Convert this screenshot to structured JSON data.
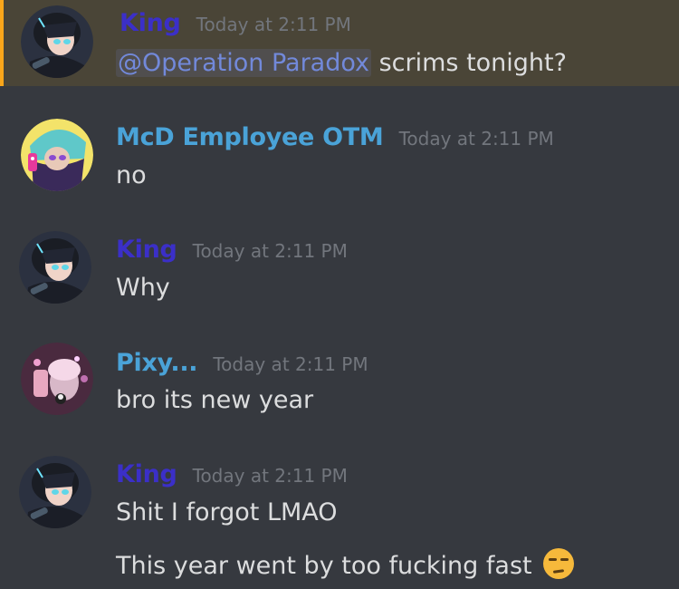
{
  "colors": {
    "background": "#36393f",
    "mention_highlight": "#4a4537",
    "mention_bar": "#faa61a",
    "king_name": "#3b2fc8",
    "member_name": "#4aa3d8",
    "timestamp": "#72767d",
    "message_text": "#dcddde",
    "mention_link": "#7289da"
  },
  "messages": [
    {
      "author": "King",
      "timestamp": "Today at 2:11 PM",
      "mention": "@Operation Paradox",
      "text": " scrims tonight?",
      "avatar_icon": "dark-haired-anime-avatar"
    },
    {
      "author": "McD Employee OTM",
      "timestamp": "Today at 2:11 PM",
      "text": "no",
      "avatar_icon": "squid-girl-avatar"
    },
    {
      "author": "King",
      "timestamp": "Today at 2:11 PM",
      "text": "Why",
      "avatar_icon": "dark-haired-anime-avatar"
    },
    {
      "author": "Pixy...",
      "timestamp": "Today at 2:11 PM",
      "text": "bro its new year",
      "avatar_icon": "pink-photo-avatar"
    },
    {
      "author": "King",
      "timestamp": "Today at 2:11 PM",
      "text": "Shit I forgot LMAO",
      "text2": "This year went by too fucking fast",
      "emoji": "unamused-face-emoji",
      "avatar_icon": "dark-haired-anime-avatar"
    }
  ]
}
